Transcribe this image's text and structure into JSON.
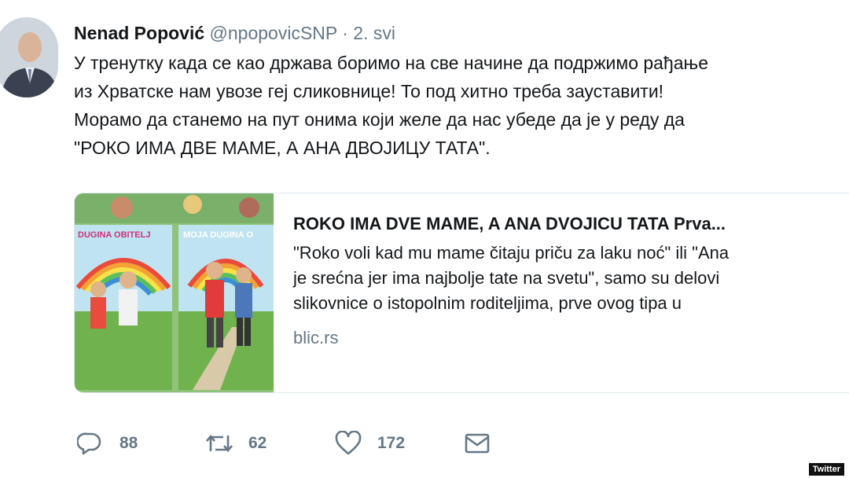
{
  "tweet": {
    "author_name": "Nenad Popović",
    "handle": "@npopovicSNP",
    "separator": "·",
    "date": "2. svi",
    "text_lines": [
      "У тренутку када се као држава боримо на све начине да подржимо рађање",
      "из Хрватске нам увозе геј сликовнице! То под хитно треба зауставити!",
      "Морамо да станемо на пут онима који желе да нас убеде да је у реду да",
      "\"РОКО ИМА ДВЕ МАМЕ, А АНА ДВОЈИЦУ ТАТА\"."
    ]
  },
  "card": {
    "image_texts": [
      "DUGINA OBITELJ",
      "MOJA DUGINA O"
    ],
    "title": "ROKO IMA DVE MAME, A ANA DVOJICU TATA Prva...",
    "description_lines": [
      "\"Roko voli kad mu mame čitaju priču za laku noć\" ili \"Ana",
      "je srećna jer ima najbolje tate na svetu\", samo su delovi",
      "slikovnice o istopolnim roditeljima, prve ovog tipa u"
    ],
    "domain": "blic.rs"
  },
  "actions": {
    "reply_count": "88",
    "retweet_count": "62",
    "like_count": "172",
    "icons": [
      "reply-icon",
      "retweet-icon",
      "like-icon",
      "message-icon"
    ]
  },
  "watermark": "Twitter"
}
